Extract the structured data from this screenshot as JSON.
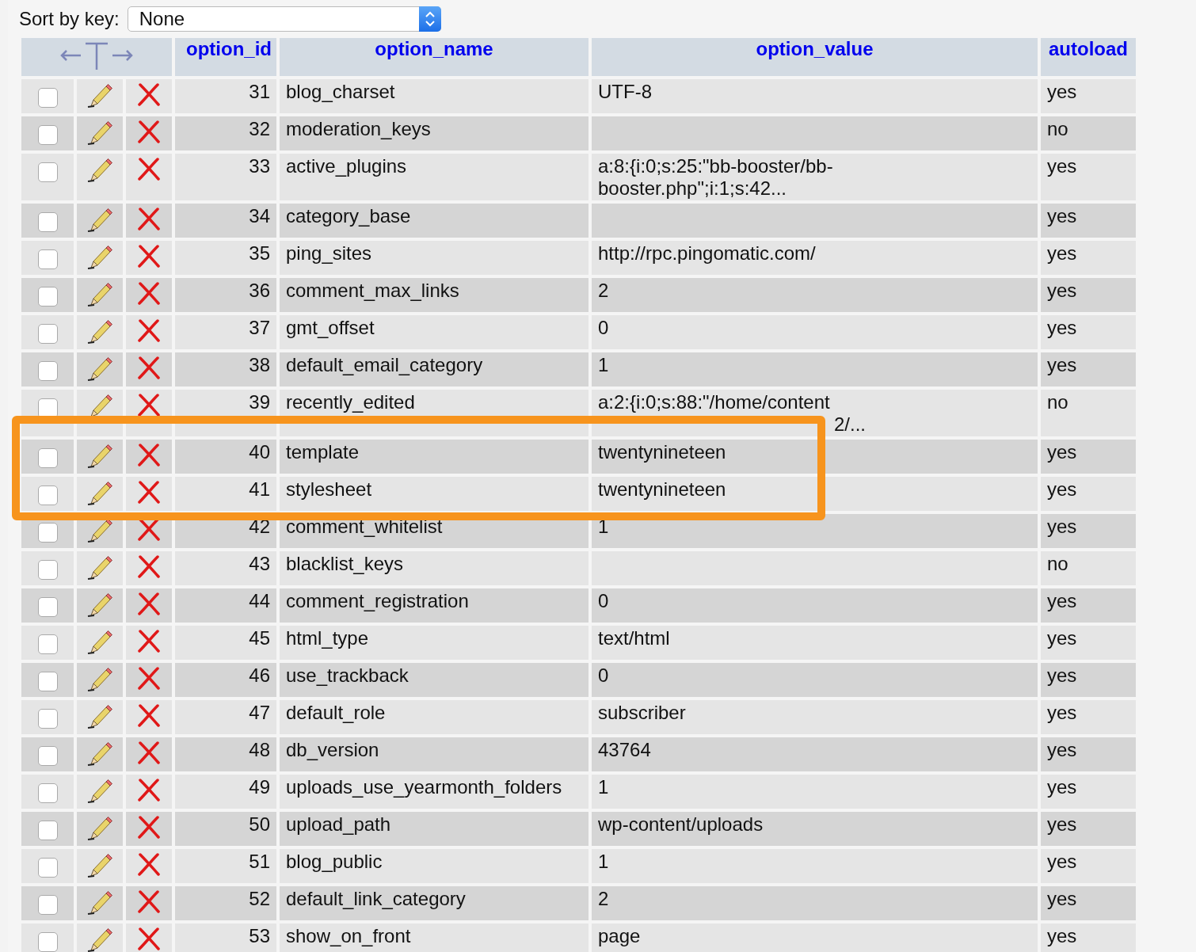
{
  "sort": {
    "label": "Sort by key:",
    "value": "None"
  },
  "columns": [
    "option_id",
    "option_name",
    "option_value",
    "autoload"
  ],
  "rows": [
    {
      "id": "31",
      "name": "blog_charset",
      "value": "UTF-8",
      "autoload": "yes",
      "checked": false,
      "highlighted": false
    },
    {
      "id": "32",
      "name": "moderation_keys",
      "value": "",
      "autoload": "no",
      "checked": false,
      "highlighted": false
    },
    {
      "id": "33",
      "name": "active_plugins",
      "value": "a:8:{i:0;s:25:\"bb-booster/bb-booster.php\";i:1;s:42...",
      "autoload": "yes",
      "checked": false,
      "highlighted": false
    },
    {
      "id": "34",
      "name": "category_base",
      "value": "",
      "autoload": "yes",
      "checked": false,
      "highlighted": false
    },
    {
      "id": "35",
      "name": "ping_sites",
      "value": "http://rpc.pingomatic.com/",
      "autoload": "yes",
      "checked": false,
      "highlighted": false
    },
    {
      "id": "36",
      "name": "comment_max_links",
      "value": "2",
      "autoload": "yes",
      "checked": false,
      "highlighted": false
    },
    {
      "id": "37",
      "name": "gmt_offset",
      "value": "0",
      "autoload": "yes",
      "checked": false,
      "highlighted": false
    },
    {
      "id": "38",
      "name": "default_email_category",
      "value": "1",
      "autoload": "yes",
      "checked": false,
      "highlighted": false
    },
    {
      "id": "39",
      "name": "recently_edited",
      "value": "a:2:{i:0;s:88:\"/home/content",
      "value_continued": "2/...",
      "autoload": "no",
      "checked": false,
      "highlighted": false
    },
    {
      "id": "40",
      "name": "template",
      "value": "twentynineteen",
      "autoload": "yes",
      "checked": false,
      "highlighted": true
    },
    {
      "id": "41",
      "name": "stylesheet",
      "value": "twentynineteen",
      "autoload": "yes",
      "checked": false,
      "highlighted": true
    },
    {
      "id": "42",
      "name": "comment_whitelist",
      "value": "1",
      "autoload": "yes",
      "checked": false,
      "highlighted": false
    },
    {
      "id": "43",
      "name": "blacklist_keys",
      "value": "",
      "autoload": "no",
      "checked": false,
      "highlighted": false
    },
    {
      "id": "44",
      "name": "comment_registration",
      "value": "0",
      "autoload": "yes",
      "checked": false,
      "highlighted": false
    },
    {
      "id": "45",
      "name": "html_type",
      "value": "text/html",
      "autoload": "yes",
      "checked": false,
      "highlighted": false
    },
    {
      "id": "46",
      "name": "use_trackback",
      "value": "0",
      "autoload": "yes",
      "checked": false,
      "highlighted": false
    },
    {
      "id": "47",
      "name": "default_role",
      "value": "subscriber",
      "autoload": "yes",
      "checked": false,
      "highlighted": false
    },
    {
      "id": "48",
      "name": "db_version",
      "value": "43764",
      "autoload": "yes",
      "checked": false,
      "highlighted": false
    },
    {
      "id": "49",
      "name": "uploads_use_yearmonth_folders",
      "value": "1",
      "autoload": "yes",
      "checked": false,
      "highlighted": false
    },
    {
      "id": "50",
      "name": "upload_path",
      "value": "wp-content/uploads",
      "autoload": "yes",
      "checked": false,
      "highlighted": false
    },
    {
      "id": "51",
      "name": "blog_public",
      "value": "1",
      "autoload": "yes",
      "checked": false,
      "highlighted": false
    },
    {
      "id": "52",
      "name": "default_link_category",
      "value": "2",
      "autoload": "yes",
      "checked": false,
      "highlighted": false
    },
    {
      "id": "53",
      "name": "show_on_front",
      "value": "page",
      "autoload": "yes",
      "checked": false,
      "highlighted": false
    }
  ]
}
